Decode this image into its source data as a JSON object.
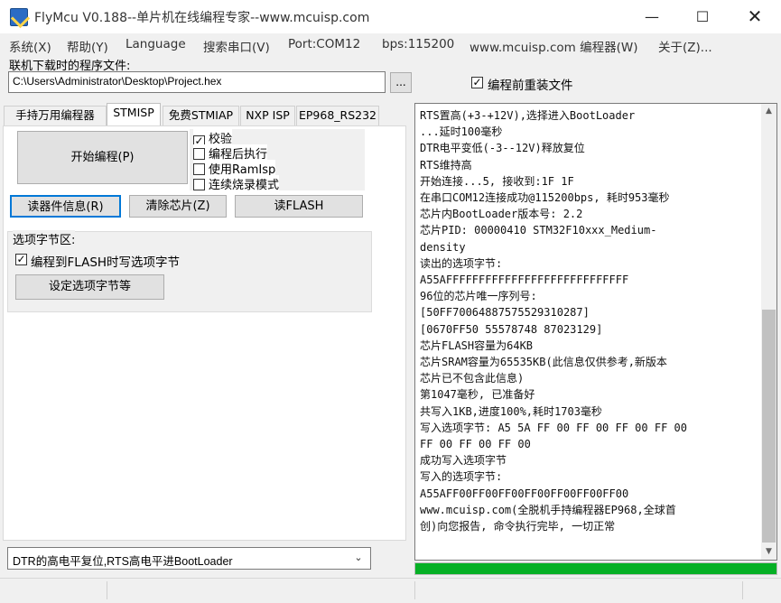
{
  "window": {
    "title": "FlyMcu V0.188--单片机在线编程专家--www.mcuisp.com"
  },
  "menu": [
    "系统(X)",
    "帮助(Y)",
    "Language",
    "搜索串口(V)",
    "Port:COM12",
    "bps:115200",
    "www.mcuisp.com 编程器(W)",
    "关于(Z)..."
  ],
  "file": {
    "label": "联机下载时的程序文件:",
    "path": "C:\\Users\\Administrator\\Desktop\\Project.hex",
    "browse": "...",
    "reload_label": "编程前重装文件",
    "reload_checked": true
  },
  "tabs": [
    "手持万用编程器",
    "STMISP",
    "免费STMIAP",
    "NXP ISP",
    "EP968_RS232"
  ],
  "active_tab": "STMISP",
  "stmisp": {
    "start_button": "开始编程(P)",
    "options": [
      {
        "label": "校验",
        "checked": true
      },
      {
        "label": "编程后执行",
        "checked": false
      },
      {
        "label": "使用RamIsp",
        "checked": false
      },
      {
        "label": "连续烧录模式",
        "checked": false
      }
    ],
    "read_info_button": "读器件信息(R)",
    "erase_button": "清除芯片(Z)",
    "read_flash_button": "读FLASH",
    "option_group_title": "选项字节区:",
    "write_option_label": "编程到FLASH时写选项字节",
    "write_option_checked": true,
    "set_option_button": "设定选项字节等"
  },
  "dtr_mode": "DTR的高电平复位,RTS高电平进BootLoader",
  "log": [
    "RTS置高(+3-+12V),选择进入BootLoader",
    "...延时100毫秒",
    "DTR电平变低(-3--12V)释放复位",
    "RTS维持高",
    "开始连接...5, 接收到:1F 1F",
    "在串口COM12连接成功@115200bps, 耗时953毫秒",
    "芯片内BootLoader版本号: 2.2",
    "芯片PID: 00000410  STM32F10xxx_Medium-",
    "density",
    "读出的选项字节:",
    "A55AFFFFFFFFFFFFFFFFFFFFFFFFFFFF",
    "96位的芯片唯一序列号:",
    "[50FF70064887575529310287]",
    "[0670FF50 55578748 87023129]",
    "芯片FLASH容量为64KB",
    "芯片SRAM容量为65535KB(此信息仅供参考,新版本",
    "芯片已不包含此信息)",
    "第1047毫秒, 已准备好",
    "共写入1KB,进度100%,耗时1703毫秒",
    "写入选项字节:  A5 5A FF 00 FF 00 FF 00 FF 00",
    "FF 00 FF 00 FF 00",
    "成功写入选项字节",
    "写入的选项字节:",
    "A55AFF00FF00FF00FF00FF00FF00FF00",
    "www.mcuisp.com(全脱机手持编程器EP968,全球首",
    "创)向您报告, 命令执行完毕, 一切正常"
  ],
  "progress": 1.0,
  "colors": {
    "progress": "#06b025",
    "focus": "#0078d7"
  }
}
